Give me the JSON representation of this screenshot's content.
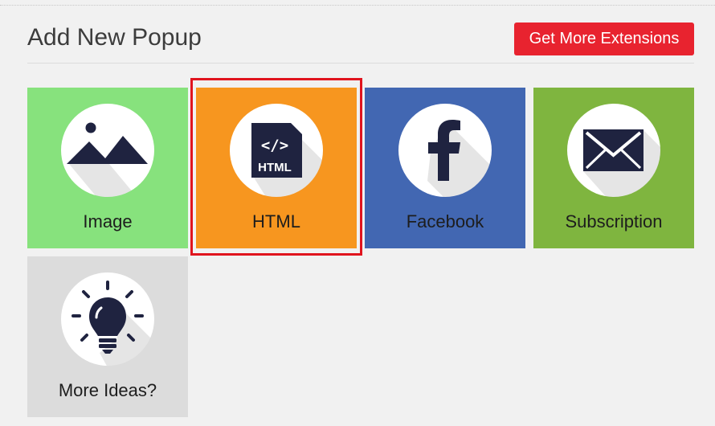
{
  "header": {
    "title": "Add New Popup",
    "extensions_button": "Get More Extensions"
  },
  "tiles": [
    {
      "label": "Image",
      "icon": "image-icon",
      "color": "#87e27d"
    },
    {
      "label": "HTML",
      "icon": "html-file-icon",
      "color": "#f7961f",
      "icon_text": "HTML",
      "code_glyph": "</>",
      "selected": true
    },
    {
      "label": "Facebook",
      "icon": "facebook-icon",
      "color": "#4267b2"
    },
    {
      "label": "Subscription",
      "icon": "envelope-icon",
      "color": "#7fb53f"
    },
    {
      "label": "More Ideas?",
      "icon": "lightbulb-icon",
      "color": "#dcdcdc"
    }
  ],
  "colors": {
    "accent_red": "#e8232f",
    "selection_border": "#e0141e",
    "icon_dark": "#1f2340"
  }
}
